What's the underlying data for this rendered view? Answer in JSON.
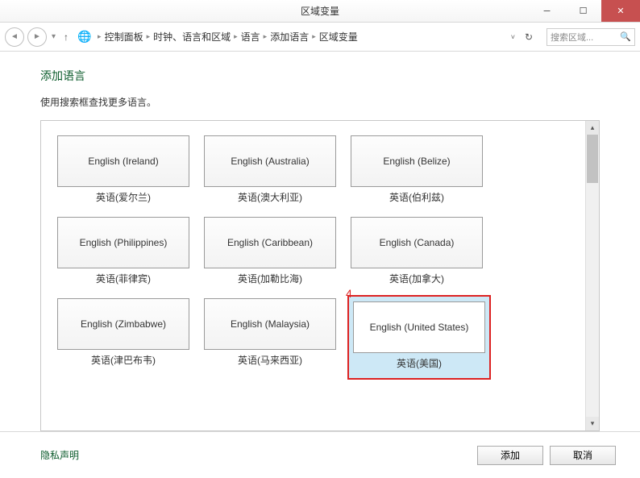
{
  "window": {
    "title": "区域变量"
  },
  "nav": {
    "crumbs": [
      "控制面板",
      "时钟、语言和区域",
      "语言",
      "添加语言",
      "区域变量"
    ],
    "search_placeholder": "搜索区域..."
  },
  "page": {
    "title": "添加语言",
    "subtitle": "使用搜索框查找更多语言。",
    "annotation": "4"
  },
  "tiles": [
    {
      "en": "English (Ireland)",
      "zh": "英语(爱尔兰)",
      "selected": false
    },
    {
      "en": "English (Australia)",
      "zh": "英语(澳大利亚)",
      "selected": false
    },
    {
      "en": "English (Belize)",
      "zh": "英语(伯利兹)",
      "selected": false
    },
    {
      "en": "English (Philippines)",
      "zh": "英语(菲律宾)",
      "selected": false
    },
    {
      "en": "English (Caribbean)",
      "zh": "英语(加勒比海)",
      "selected": false
    },
    {
      "en": "English (Canada)",
      "zh": "英语(加拿大)",
      "selected": false
    },
    {
      "en": "English (Zimbabwe)",
      "zh": "英语(津巴布韦)",
      "selected": false
    },
    {
      "en": "English (Malaysia)",
      "zh": "英语(马来西亚)",
      "selected": false
    },
    {
      "en": "English (United States)",
      "zh": "英语(美国)",
      "selected": true
    }
  ],
  "footer": {
    "privacy": "隐私声明",
    "add": "添加",
    "cancel": "取消"
  }
}
